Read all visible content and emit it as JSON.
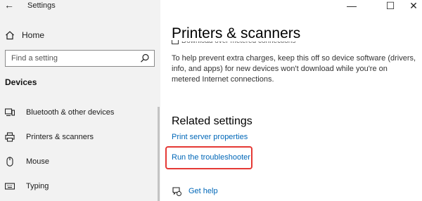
{
  "window": {
    "title": "Settings",
    "back_icon": "back-arrow-icon",
    "controls": [
      "minimize-icon",
      "maximize-icon",
      "close-icon"
    ]
  },
  "sidebar": {
    "home_label": "Home",
    "search_placeholder": "Find a setting",
    "section_heading": "Devices",
    "items": [
      {
        "label": "Bluetooth & other devices",
        "icon": "bluetooth-devices-icon"
      },
      {
        "label": "Printers & scanners",
        "icon": "printer-icon"
      },
      {
        "label": "Mouse",
        "icon": "mouse-icon"
      },
      {
        "label": "Typing",
        "icon": "keyboard-icon"
      }
    ]
  },
  "main": {
    "page_title": "Printers & scanners",
    "cut_off_text": "Download over metered connections",
    "description": "To help prevent extra charges, keep this off so device software (drivers, info, and apps) for new devices won't download while you're on metered Internet connections.",
    "related_heading": "Related settings",
    "links": {
      "print_server": "Print server properties",
      "troubleshooter": "Run the troubleshooter"
    },
    "help_label": "Get help"
  },
  "colors": {
    "sidebar_bg": "#f2f2f2",
    "link": "#0067b8",
    "highlight_box": "#e53935"
  }
}
